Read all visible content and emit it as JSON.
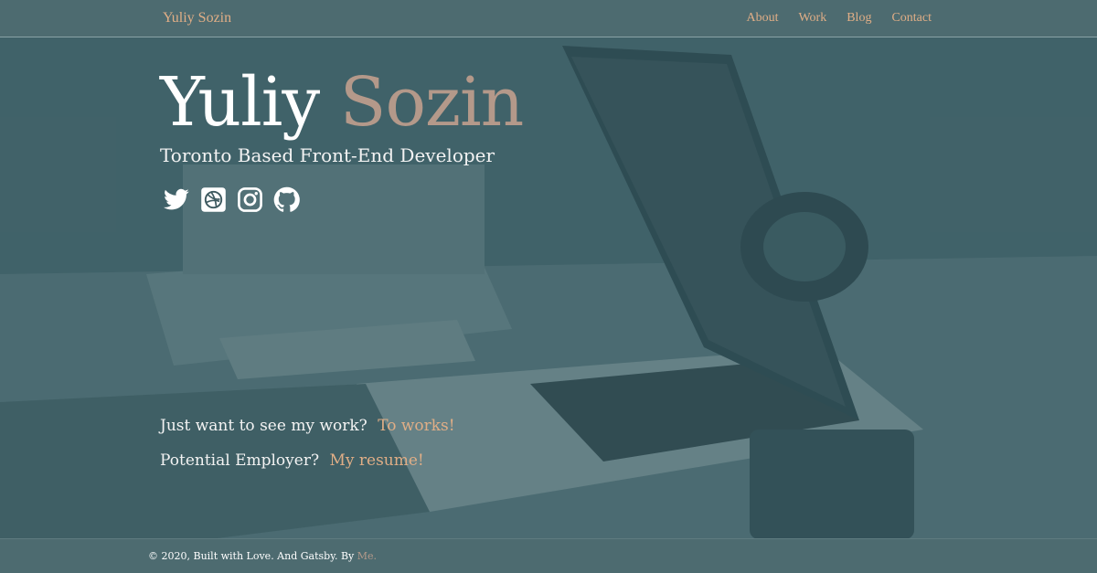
{
  "nav": {
    "brand": "Yuliy Sozin",
    "links": [
      "About",
      "Work",
      "Blog",
      "Contact"
    ]
  },
  "hero": {
    "first_name": "Yuliy",
    "last_name": "Sozin",
    "subtitle": "Toronto Based Front-End Developer",
    "social_icons": [
      "twitter-icon",
      "dribbble-icon",
      "instagram-icon",
      "github-icon"
    ]
  },
  "cta": {
    "work_prompt": "Just want to see my work?",
    "work_link": "To works!",
    "resume_prompt": "Potential Employer?",
    "resume_link": "My resume!"
  },
  "footer": {
    "text": "© 2020, Built with Love. And Gatsby. By ",
    "link": "Me."
  },
  "colors": {
    "accent": "#e0ae86",
    "last_name": "#b4998a",
    "bar": "#4d6b70",
    "overlay": "#3e5a60"
  }
}
